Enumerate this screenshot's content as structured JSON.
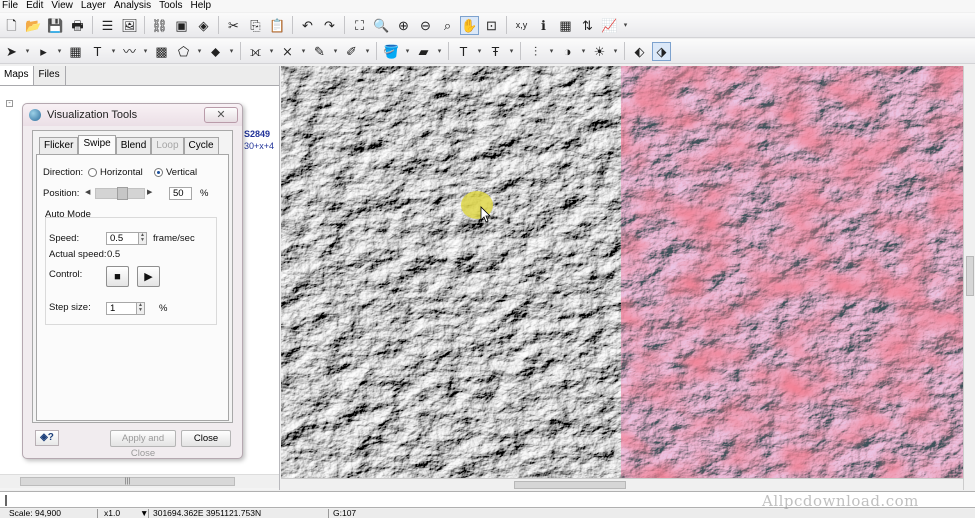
{
  "menu": [
    "File",
    "Edit",
    "View",
    "Layer",
    "Analysis",
    "Tools",
    "Help"
  ],
  "toolbar1": [
    {
      "name": "new-icon",
      "glyph": "🗋"
    },
    {
      "name": "open-icon",
      "glyph": "📂"
    },
    {
      "name": "save-icon",
      "glyph": "💾"
    },
    {
      "name": "print-icon",
      "glyph": "🖶"
    },
    {
      "name": "sep"
    },
    {
      "name": "layer-list-icon",
      "glyph": "☰"
    },
    {
      "name": "overview-icon",
      "glyph": "🖼"
    },
    {
      "name": "sep"
    },
    {
      "name": "link-icon",
      "glyph": "⛓"
    },
    {
      "name": "window-icon",
      "glyph": "▣"
    },
    {
      "name": "layers-icon",
      "glyph": "◈"
    },
    {
      "name": "sep"
    },
    {
      "name": "cut-icon",
      "glyph": "✂"
    },
    {
      "name": "copy-icon",
      "glyph": "⎘"
    },
    {
      "name": "paste-icon",
      "glyph": "📋"
    },
    {
      "name": "sep"
    },
    {
      "name": "undo-icon",
      "glyph": "↶"
    },
    {
      "name": "redo-icon",
      "glyph": "↷"
    },
    {
      "name": "sep"
    },
    {
      "name": "fit-to-frame-icon",
      "glyph": "⛶"
    },
    {
      "name": "zoom-box-icon",
      "glyph": "🔍"
    },
    {
      "name": "zoom-in-icon",
      "glyph": "⊕"
    },
    {
      "name": "zoom-out-icon",
      "glyph": "⊖"
    },
    {
      "name": "zoom-selection-icon",
      "glyph": "⌕"
    },
    {
      "name": "pan-icon",
      "glyph": "✋",
      "active": true
    },
    {
      "name": "full-extent-icon",
      "glyph": "⊡"
    },
    {
      "name": "sep"
    },
    {
      "name": "coordinate-icon",
      "glyph": "x,y"
    },
    {
      "name": "info-icon",
      "glyph": "ℹ"
    },
    {
      "name": "attribute-table-icon",
      "glyph": "▦"
    },
    {
      "name": "sort-icon",
      "glyph": "⇅"
    },
    {
      "name": "chart-icon",
      "glyph": "📈"
    },
    {
      "name": "drop"
    }
  ],
  "toolbar2": [
    {
      "name": "select-arrow-icon",
      "glyph": "➤"
    },
    {
      "name": "drop"
    },
    {
      "name": "vertex-select-icon",
      "glyph": "▸"
    },
    {
      "name": "drop"
    },
    {
      "name": "grid-icon",
      "glyph": "▦"
    },
    {
      "name": "text-icon",
      "glyph": "T"
    },
    {
      "name": "drop"
    },
    {
      "name": "draw-line-icon",
      "glyph": "〰"
    },
    {
      "name": "drop"
    },
    {
      "name": "raster-edit-icon",
      "glyph": "▩"
    },
    {
      "name": "polygon-icon",
      "glyph": "⬠"
    },
    {
      "name": "drop"
    },
    {
      "name": "fill-icon",
      "glyph": "⬥"
    },
    {
      "name": "drop"
    },
    {
      "name": "sep"
    },
    {
      "name": "node-tool-icon",
      "glyph": "⟗"
    },
    {
      "name": "drop"
    },
    {
      "name": "cross-tool-icon",
      "glyph": "⨯"
    },
    {
      "name": "drop"
    },
    {
      "name": "pen-color-icon",
      "glyph": "✎"
    },
    {
      "name": "drop"
    },
    {
      "name": "line-style-icon",
      "glyph": "✐"
    },
    {
      "name": "drop"
    },
    {
      "name": "sep"
    },
    {
      "name": "paint-bucket-icon",
      "glyph": "🪣"
    },
    {
      "name": "drop"
    },
    {
      "name": "highlight-icon",
      "glyph": "▰"
    },
    {
      "name": "drop"
    },
    {
      "name": "sep"
    },
    {
      "name": "font-icon",
      "glyph": "T"
    },
    {
      "name": "drop"
    },
    {
      "name": "font-style-icon",
      "glyph": "Ŧ"
    },
    {
      "name": "drop"
    },
    {
      "name": "sep"
    },
    {
      "name": "align-icon",
      "glyph": "⫶"
    },
    {
      "name": "drop"
    },
    {
      "name": "contrast-icon",
      "glyph": "◑"
    },
    {
      "name": "drop"
    },
    {
      "name": "brightness-icon",
      "glyph": "☀"
    },
    {
      "name": "drop"
    },
    {
      "name": "sep"
    },
    {
      "name": "layer-stack-icon",
      "glyph": "⬖"
    },
    {
      "name": "visualization-tools-icon",
      "glyph": "⬗",
      "active": true
    }
  ],
  "left_panel": {
    "tabs": [
      "Maps",
      "Files"
    ],
    "fragment1": "S2849",
    "fragment2": "30+x+4"
  },
  "dialog": {
    "title": "Visualization Tools",
    "tabs": [
      "Flicker",
      "Swipe",
      "Blend",
      "Loop",
      "Cycle"
    ],
    "direction_label": "Direction:",
    "horizontal_label": "Horizontal",
    "vertical_label": "Vertical",
    "position_label": "Position:",
    "position_value": "50",
    "position_unit": "%",
    "auto_mode_label": "Auto Mode",
    "speed_label": "Speed:",
    "speed_value": "0.5",
    "speed_unit": "frame/sec",
    "actual_speed_label": "Actual speed:",
    "actual_speed_value": "0.5",
    "control_label": "Control:",
    "step_size_label": "Step size:",
    "step_size_value": "1",
    "step_size_unit": "%",
    "help_label": "?",
    "apply_close_label": "Apply and Close",
    "close_label": "Close"
  },
  "status": {
    "scale": "Scale: 94,900",
    "zoom": "x1.0",
    "coords": "301694.362E 3951121.753N",
    "value": "G:107"
  },
  "watermark": "Allpcdownload.com"
}
